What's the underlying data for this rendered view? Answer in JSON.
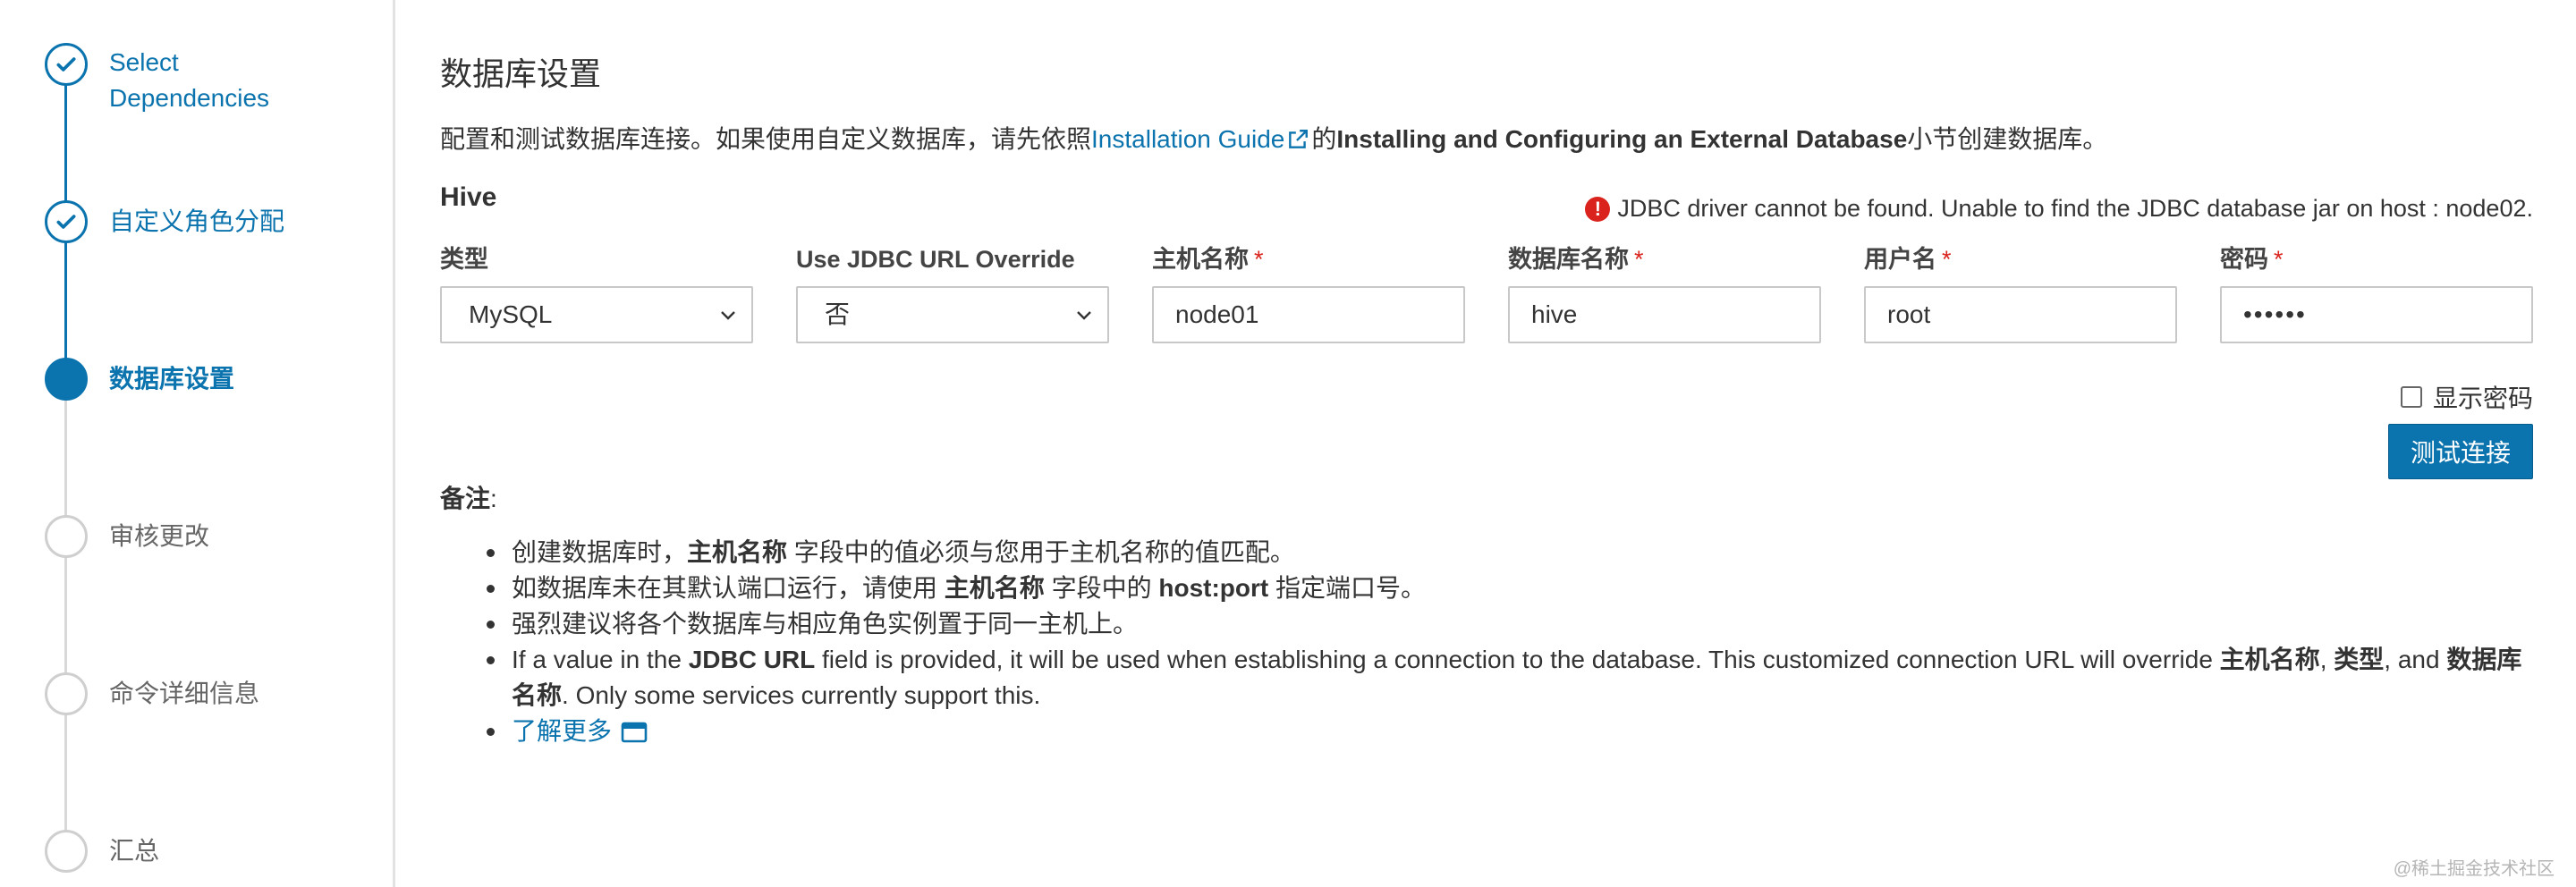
{
  "sidebar": {
    "steps": [
      {
        "label_lines": [
          "Select",
          "Dependencies"
        ],
        "state": "done"
      },
      {
        "label": "自定义角色分配",
        "state": "done"
      },
      {
        "label": "数据库设置",
        "state": "active"
      },
      {
        "label": "审核更改",
        "state": "todo"
      },
      {
        "label": "命令详细信息",
        "state": "todo"
      },
      {
        "label": "汇总",
        "state": "todo"
      }
    ]
  },
  "page": {
    "title": "数据库设置",
    "desc_prefix": "配置和测试数据库连接。如果使用自定义数据库，请先依照",
    "desc_link": "Installation Guide",
    "desc_mid": "的",
    "desc_bold": "Installing and Configuring an External Database",
    "desc_suffix": "小节创建数据库。"
  },
  "hive": {
    "section_title": "Hive",
    "alert": "JDBC driver cannot be found. Unable to find the JDBC database jar on host : node02.",
    "fields": {
      "type_label": "类型",
      "type_value": "MySQL",
      "jdbc_label": "Use JDBC URL Override",
      "jdbc_value": "否",
      "host_label": "主机名称",
      "host_value": "node01",
      "dbname_label": "数据库名称",
      "dbname_value": "hive",
      "user_label": "用户名",
      "user_value": "root",
      "password_label": "密码",
      "password_value": "••••••",
      "required_mark": "*"
    },
    "show_password": "显示密码",
    "test_button": "测试连接"
  },
  "notes": {
    "title": "备注",
    "colon": ":",
    "n1": {
      "a": "创建数据库时，",
      "b": "主机名称",
      "c": " 字段中的值必须与您用于主机名称的值匹配。"
    },
    "n2": {
      "a": "如数据库未在其默认端口运行，请使用 ",
      "b": "主机名称",
      "c": " 字段中的 ",
      "d": "host:port",
      "e": " 指定端口号。"
    },
    "n3": {
      "a": "强烈建议将各个数据库与相应角色实例置于同一主机上。"
    },
    "n4": {
      "a": "If a value in the ",
      "b": "JDBC URL",
      "c": " field is provided, it will be used when establishing a connection to the database. This customized connection URL will override ",
      "d": "主机名称",
      "e": ", ",
      "f": "类型",
      "g": ", and ",
      "h": "数据库名称",
      "i": ". Only some services currently support this."
    },
    "learn_more": "了解更多"
  },
  "watermark": "@稀土掘金技术社区",
  "colors": {
    "accent": "#0b73ad",
    "error": "#d9231c"
  }
}
